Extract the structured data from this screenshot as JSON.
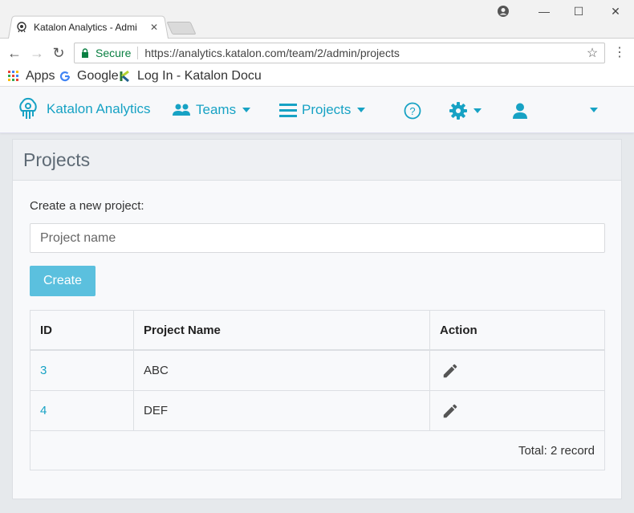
{
  "browser": {
    "tab_title": "Katalon Analytics - Admi",
    "secure_label": "Secure",
    "url": "https://analytics.katalon.com/team/2/admin/projects",
    "bookmarks": [
      {
        "label": "Apps",
        "icon": "apps-grid-icon"
      },
      {
        "label": "Google",
        "icon": "google-g-icon"
      },
      {
        "label": "Log In - Katalon Docu",
        "icon": "katalon-k-icon"
      }
    ]
  },
  "nav": {
    "brand": "Katalon Analytics",
    "teams": "Teams",
    "projects": "Projects",
    "accent_color": "#17a2c4"
  },
  "page": {
    "title": "Projects",
    "create_label": "Create a new project:",
    "input_placeholder": "Project name",
    "create_button": "Create",
    "table": {
      "headers": [
        "ID",
        "Project Name",
        "Action"
      ],
      "rows": [
        {
          "id": "3",
          "name": "ABC"
        },
        {
          "id": "4",
          "name": "DEF"
        }
      ],
      "total": "Total: 2 record"
    }
  }
}
